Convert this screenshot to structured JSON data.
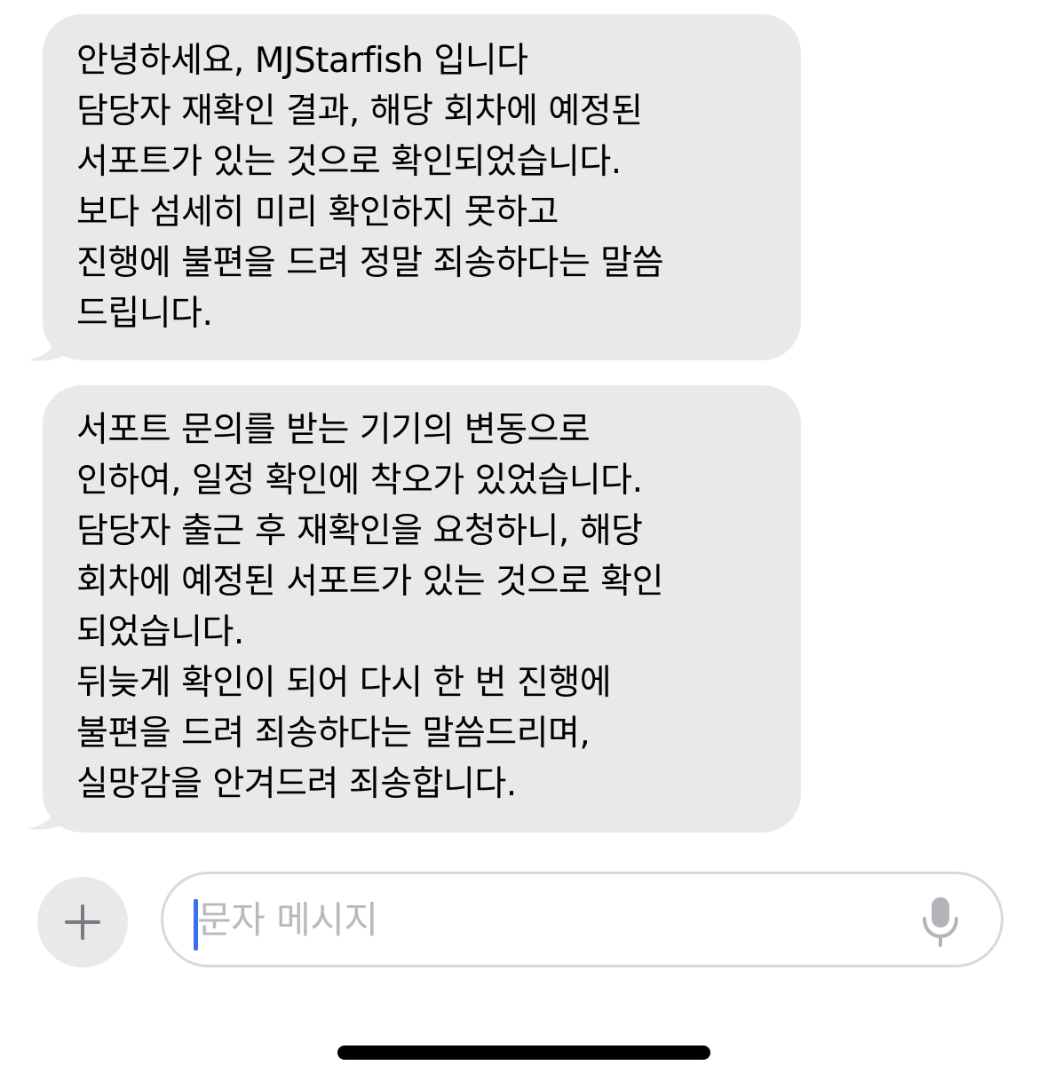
{
  "thread": {
    "messages": [
      {
        "direction": "incoming",
        "lines": [
          "안녕하세요, MJStarfish 입니다",
          "담당자 재확인 결과, 해당 회차에 예정된",
          "서포트가 있는 것으로 확인되었습니다.",
          "보다 섬세히 미리 확인하지 못하고",
          "진행에 불편을 드려 정말 죄송하다는 말씀",
          "드립니다."
        ]
      },
      {
        "direction": "incoming",
        "lines": [
          "서포트 문의를 받는 기기의 변동으로",
          "인하여, 일정 확인에 착오가 있었습니다.",
          "담당자 출근 후 재확인을 요청하니, 해당",
          "회차에 예정된 서포트가 있는 것으로 확인",
          "되었습니다.",
          "뒤늦게 확인이 되어 다시 한 번 진행에",
          "불편을 드려 죄송하다는 말씀드리며,",
          "실망감을 안겨드려 죄송합니다."
        ]
      }
    ]
  },
  "composer": {
    "add_icon": "plus-icon",
    "placeholder": "문자 메시지",
    "value": "",
    "mic_icon": "microphone-icon"
  },
  "colors": {
    "incoming_bubble": "#e9e9eb",
    "caret": "#3c6ff0",
    "placeholder": "#b9b9be"
  }
}
